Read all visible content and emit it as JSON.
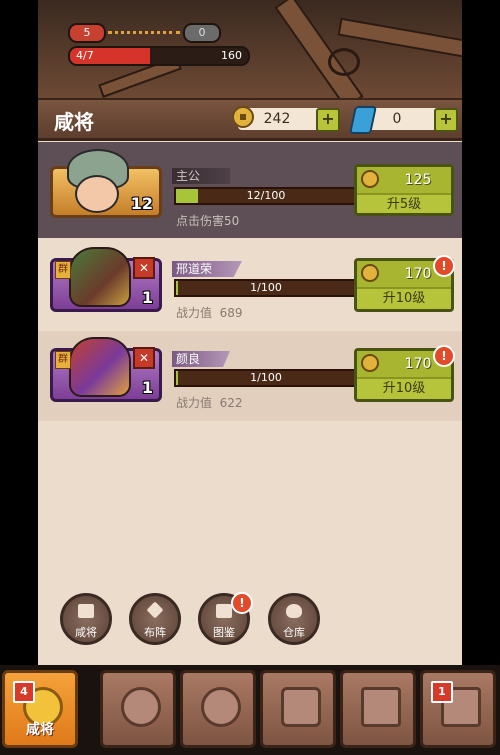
{
  "stage": {
    "current": "5",
    "next": "0",
    "hp_progress": "4/7",
    "hp_value": "160",
    "hp_fraction": 0.45
  },
  "header": {
    "title": "咸将",
    "gold": "242",
    "gems": "0"
  },
  "rows": [
    {
      "name": "主公",
      "level": "12",
      "progress": "12/100",
      "progress_fraction": 0.12,
      "stat": "点击伤害50",
      "cost": "125",
      "upgrade": "升5级",
      "alert": false
    },
    {
      "name": "邢道荣",
      "level": "1",
      "tag": "群",
      "progress": "1/100",
      "progress_fraction": 0.01,
      "stat_label": "战力值",
      "stat_value": "689",
      "cost": "170",
      "upgrade": "升10级",
      "alert": true
    },
    {
      "name": "颜良",
      "level": "1",
      "tag": "群",
      "progress": "1/100",
      "progress_fraction": 0.01,
      "stat_label": "战力值",
      "stat_value": "622",
      "cost": "170",
      "upgrade": "升10级",
      "alert": true
    }
  ],
  "round_buttons": [
    {
      "label": "咸将",
      "icon": "list-icon"
    },
    {
      "label": "布阵",
      "icon": "formation-icon"
    },
    {
      "label": "图鉴",
      "icon": "book-icon",
      "alert": true
    },
    {
      "label": "仓库",
      "icon": "bag-icon"
    }
  ],
  "nav": {
    "tabs": [
      {
        "label": "咸将",
        "badge": "4",
        "active": true
      },
      {
        "label": "",
        "icon": "armor-icon"
      },
      {
        "label": "",
        "icon": "helmet-icon"
      },
      {
        "label": "",
        "icon": "chest-icon"
      },
      {
        "label": "",
        "icon": "scroll-icon"
      },
      {
        "label": "",
        "icon": "scroll-icon",
        "badge": "1"
      }
    ]
  },
  "alert_glyph": "!",
  "colors": {
    "accent": "#b6c43c",
    "hp": "#d6342b",
    "active_tab": "#f4a23a"
  }
}
